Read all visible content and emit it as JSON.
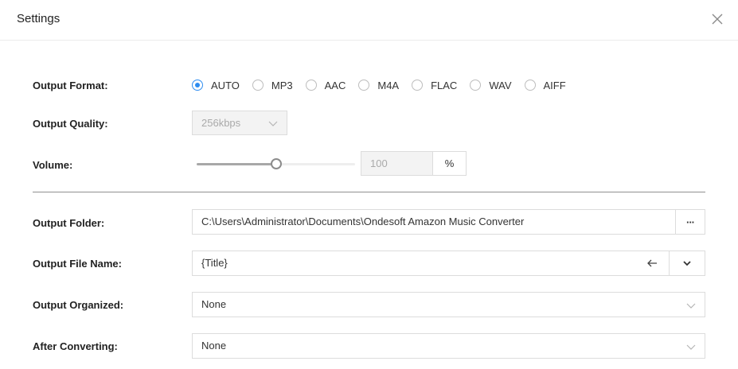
{
  "header": {
    "title": "Settings",
    "close_icon": "close-icon"
  },
  "output_format": {
    "label": "Output Format:",
    "options": [
      "AUTO",
      "MP3",
      "AAC",
      "M4A",
      "FLAC",
      "WAV",
      "AIFF"
    ],
    "selected": "AUTO",
    "accent": "#2d8cf0"
  },
  "output_quality": {
    "label": "Output Quality:",
    "value": "256kbps"
  },
  "volume": {
    "label": "Volume:",
    "level": 0.5,
    "value": "100",
    "unit": "%"
  },
  "output_folder": {
    "label": "Output Folder:",
    "value": "C:\\Users\\Administrator\\Documents\\Ondesoft Amazon Music Converter",
    "browse_label": "···"
  },
  "output_file_name": {
    "label": "Output File Name:",
    "value": "{Title}"
  },
  "output_organized": {
    "label": "Output Organized:",
    "value": "None"
  },
  "after_converting": {
    "label": "After Converting:",
    "value": "None"
  }
}
